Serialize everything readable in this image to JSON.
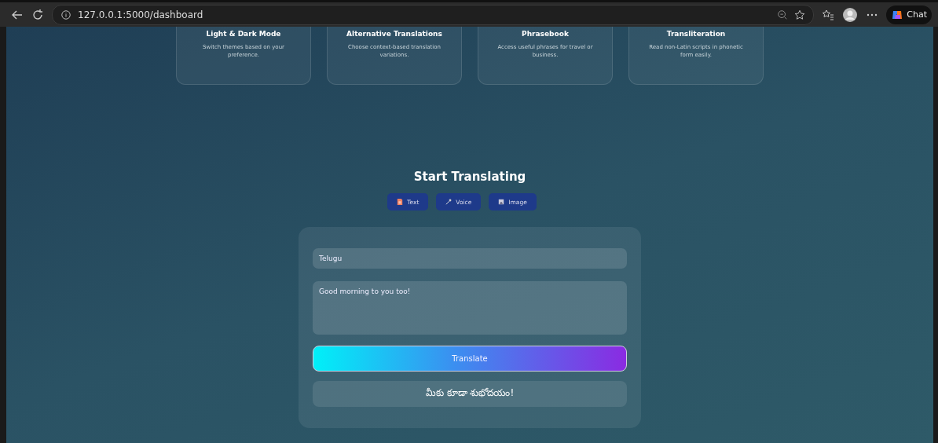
{
  "browser": {
    "url": "127.0.0.1:5000/dashboard",
    "chat_label": "Chat"
  },
  "features": [
    {
      "title": "Light & Dark Mode",
      "text": "Switch themes based on your preference."
    },
    {
      "title": "Alternative Translations",
      "text": "Choose context-based translation variations."
    },
    {
      "title": "Phrasebook",
      "text": "Access useful phrases for travel or business."
    },
    {
      "title": "Transliteration",
      "text": "Read non-Latin scripts in phonetic form easily."
    }
  ],
  "translator": {
    "heading": "Start Translating",
    "modes": [
      {
        "kind": "text",
        "label": "Text"
      },
      {
        "kind": "voice",
        "label": "Voice"
      },
      {
        "kind": "image",
        "label": "Image"
      }
    ],
    "language": "Telugu",
    "input": "Good morning to you too!",
    "button": "Translate",
    "result": "మీకు కూడా శుభోదయం!"
  }
}
